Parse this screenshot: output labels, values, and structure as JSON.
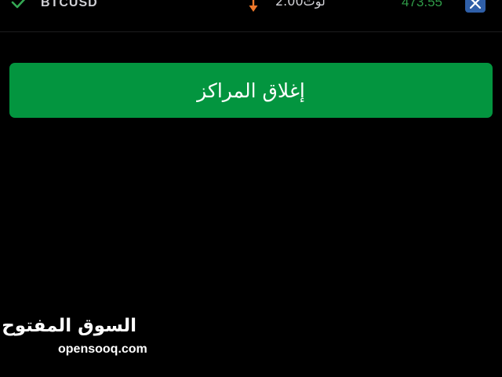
{
  "position": {
    "symbol": "BTCUSD",
    "lot_unit": "لوت",
    "lot_value": "2.00",
    "price": "473.55",
    "check_icon": "check-icon",
    "direction_icon": "arrow-down-icon",
    "close_icon": "close-icon"
  },
  "actions": {
    "close_positions_label": "إغلاق المراكز"
  },
  "watermark": {
    "arabic": "السوق المفتوح",
    "latin": "opensooq.com"
  },
  "colors": {
    "background": "#000000",
    "button_green": "#03953f",
    "price_green": "#2f9b48",
    "check_green": "#34a853",
    "arrow_orange": "#f0782a",
    "close_blue": "#2f5fa8"
  }
}
